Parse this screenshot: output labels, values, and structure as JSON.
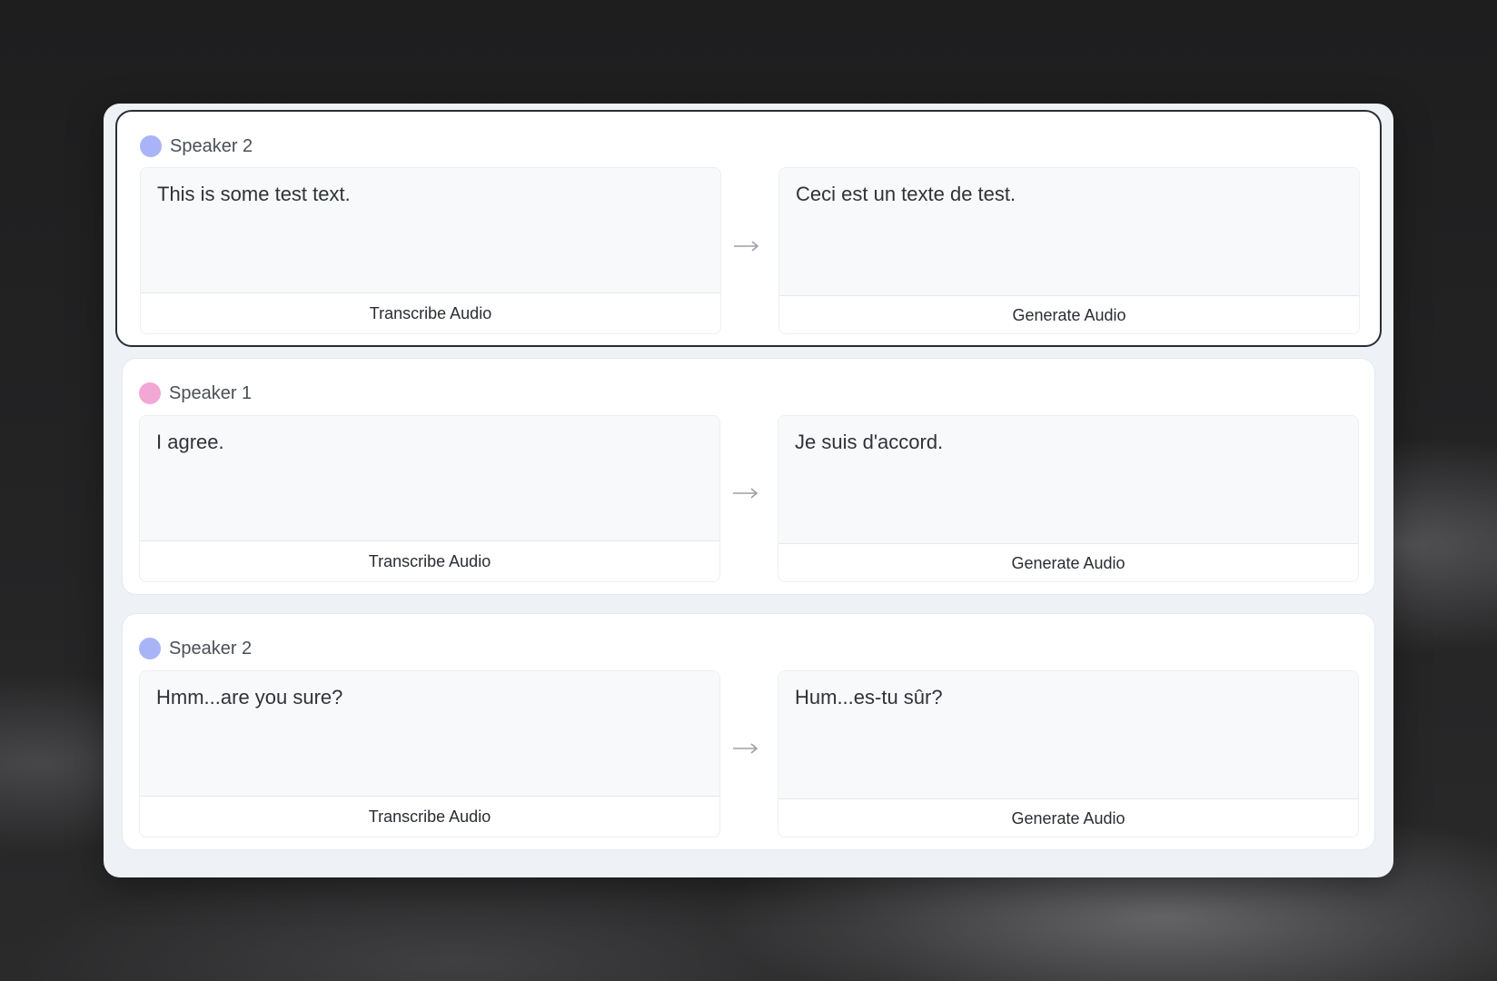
{
  "colors": {
    "speaker1": "#f2a7d5",
    "speaker2": "#a9b4f8",
    "selected_border": "#2a2d33",
    "panel_bg": "#eef2f7"
  },
  "icons": {
    "arrow": "arrow-right-icon"
  },
  "segments": [
    {
      "speaker": "Speaker 2",
      "speaker_color": "speaker2",
      "selected": true,
      "source_text": "This is some test text.",
      "target_text": "Ceci est un texte de test.",
      "source_action": "Transcribe Audio",
      "target_action": "Generate Audio"
    },
    {
      "speaker": "Speaker 1",
      "speaker_color": "speaker1",
      "selected": false,
      "source_text": "I agree.",
      "target_text": "Je suis d'accord.",
      "source_action": "Transcribe Audio",
      "target_action": "Generate Audio"
    },
    {
      "speaker": "Speaker 2",
      "speaker_color": "speaker2",
      "selected": false,
      "source_text": "Hmm...are you sure?",
      "target_text": "Hum...es-tu sûr?",
      "source_action": "Transcribe Audio",
      "target_action": "Generate Audio"
    }
  ]
}
